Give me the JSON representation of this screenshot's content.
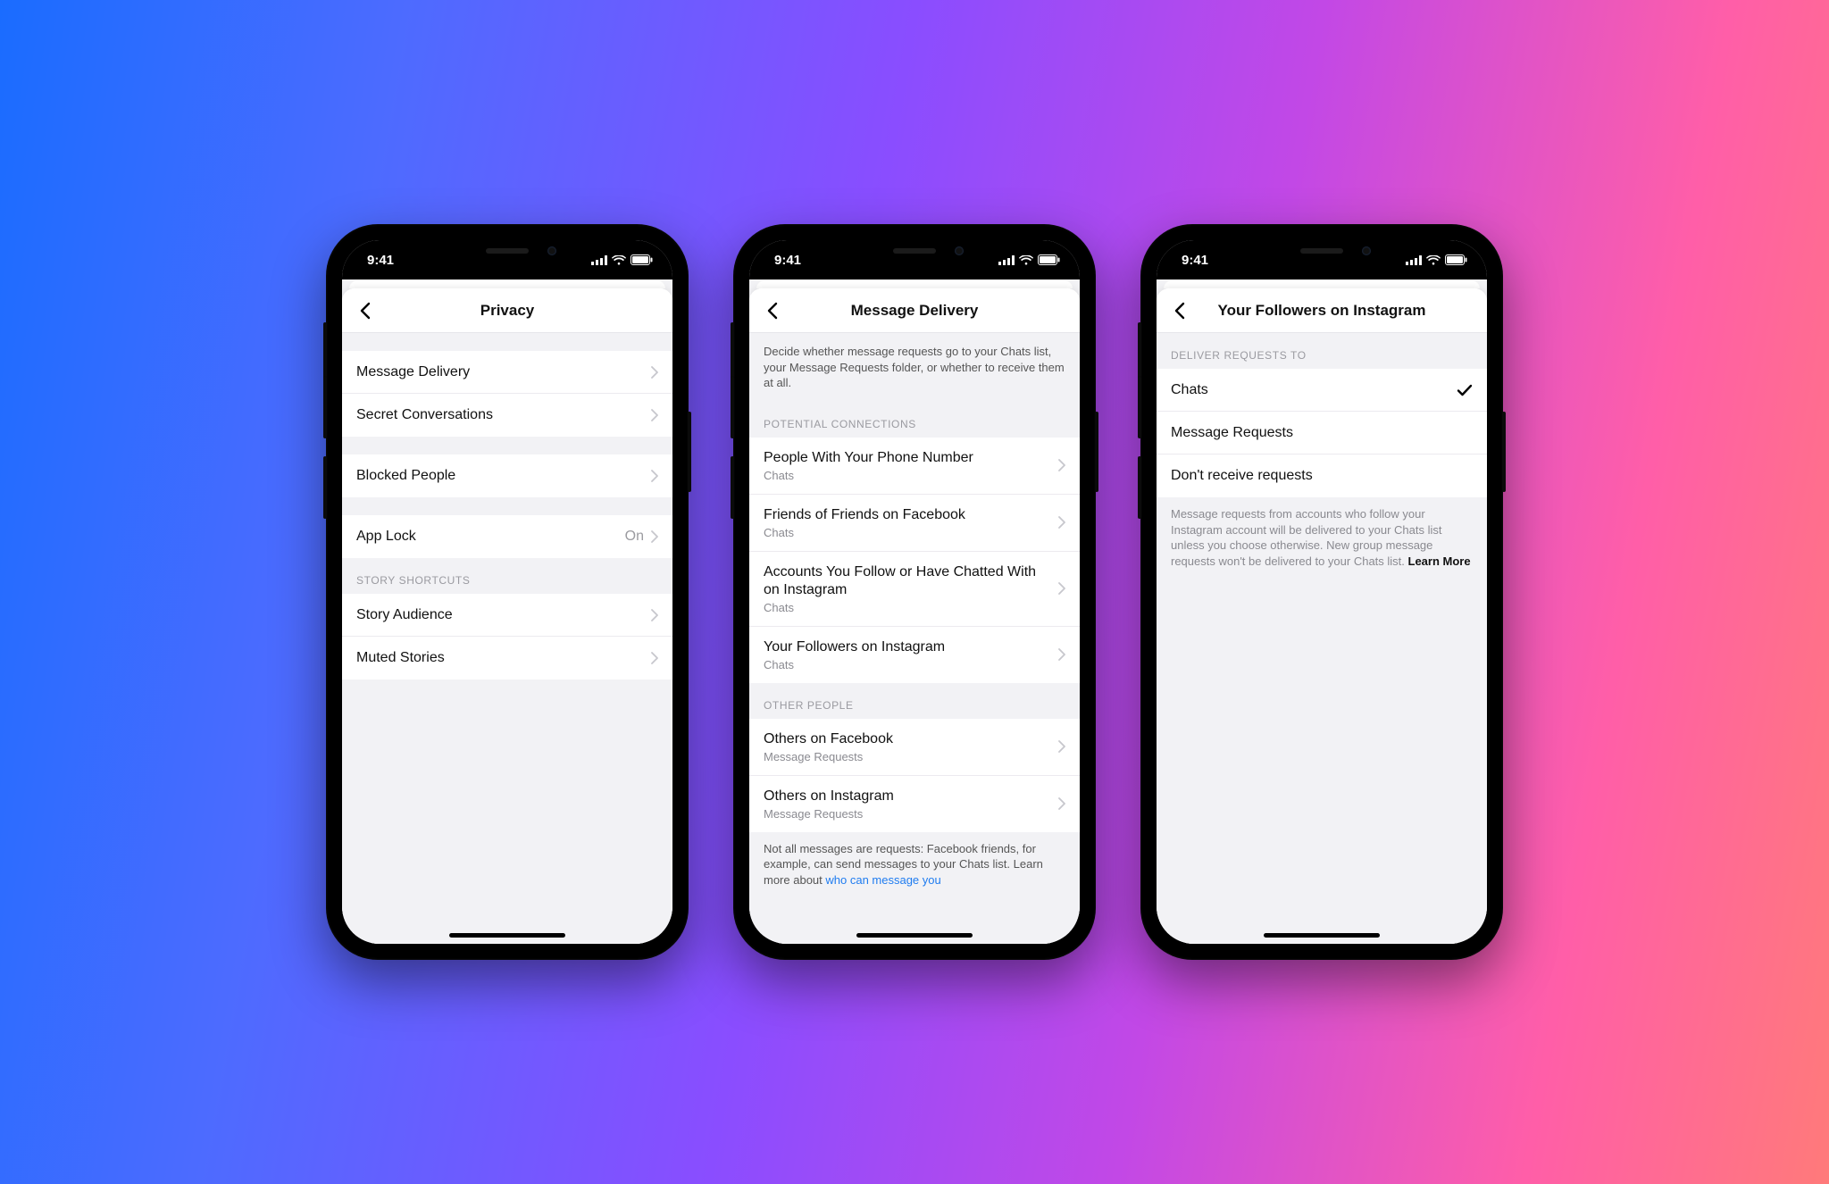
{
  "status": {
    "time": "9:41"
  },
  "phones": [
    {
      "title": "Privacy",
      "sections": [
        {
          "header": null,
          "rows": [
            {
              "label": "Message Delivery",
              "sub": null,
              "value": null,
              "chevron": true
            },
            {
              "label": "Secret Conversations",
              "sub": null,
              "value": null,
              "chevron": true
            }
          ]
        },
        {
          "header": null,
          "rows": [
            {
              "label": "Blocked People",
              "sub": null,
              "value": null,
              "chevron": true
            }
          ]
        },
        {
          "header": null,
          "rows": [
            {
              "label": "App Lock",
              "sub": null,
              "value": "On",
              "chevron": true
            }
          ]
        },
        {
          "header": "STORY SHORTCUTS",
          "rows": [
            {
              "label": "Story Audience",
              "sub": null,
              "value": null,
              "chevron": true
            },
            {
              "label": "Muted Stories",
              "sub": null,
              "value": null,
              "chevron": true
            }
          ]
        }
      ]
    },
    {
      "title": "Message Delivery",
      "intro": "Decide whether message requests go to your Chats list, your Message Requests folder, or whether to receive them at all.",
      "sections": [
        {
          "header": "POTENTIAL CONNECTIONS",
          "rows": [
            {
              "label": "People With Your Phone Number",
              "sub": "Chats",
              "chevron": true
            },
            {
              "label": "Friends of Friends on Facebook",
              "sub": "Chats",
              "chevron": true
            },
            {
              "label": "Accounts You Follow or Have Chatted With on Instagram",
              "sub": "Chats",
              "chevron": true
            },
            {
              "label": "Your Followers on Instagram",
              "sub": "Chats",
              "chevron": true
            }
          ]
        },
        {
          "header": "OTHER PEOPLE",
          "rows": [
            {
              "label": "Others on Facebook",
              "sub": "Message Requests",
              "chevron": true
            },
            {
              "label": "Others on Instagram",
              "sub": "Message Requests",
              "chevron": true
            }
          ]
        }
      ],
      "footnote": {
        "text": "Not all messages are requests: Facebook friends, for example, can send messages to your Chats list. Learn more about ",
        "link": "who can message you"
      }
    },
    {
      "title": "Your Followers on Instagram",
      "sections": [
        {
          "header": "DELIVER REQUESTS TO",
          "rows": [
            {
              "label": "Chats",
              "checked": true
            },
            {
              "label": "Message Requests",
              "checked": false
            },
            {
              "label": "Don't receive requests",
              "checked": false
            }
          ]
        }
      ],
      "footnote": {
        "text": "Message requests from accounts who follow your Instagram account will be delivered to your Chats list unless you choose otherwise. New group message requests won't be delivered to your Chats list. ",
        "bold": "Learn More"
      }
    }
  ]
}
